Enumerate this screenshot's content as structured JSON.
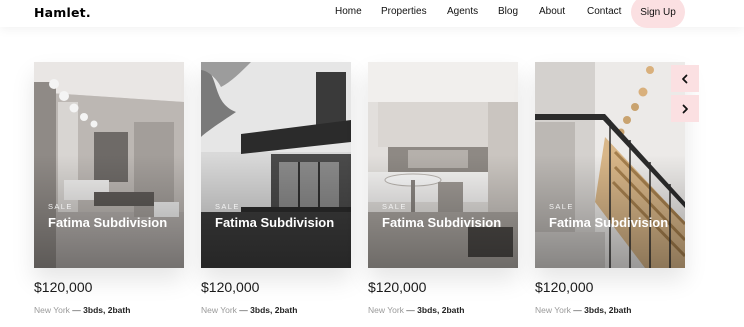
{
  "brand": {
    "name": "Hamlet."
  },
  "nav": {
    "links": [
      "Home",
      "Properties",
      "Agents",
      "Blog",
      "About",
      "Contact"
    ],
    "cta": "Sign Up"
  },
  "listings": [
    {
      "badge": "SALE",
      "title": "Fatima Subdivision",
      "price": "$120,000",
      "city": "New York",
      "separator": "—",
      "specs": "3bds, 2bath"
    },
    {
      "badge": "SALE",
      "title": "Fatima Subdivision",
      "price": "$120,000",
      "city": "New York",
      "separator": "—",
      "specs": "3bds, 2bath"
    },
    {
      "badge": "SALE",
      "title": "Fatima Subdivision",
      "price": "$120,000",
      "city": "New York",
      "separator": "—",
      "specs": "3bds, 2bath"
    },
    {
      "badge": "SALE",
      "title": "Fatima Subdivision",
      "price": "$120,000",
      "city": "New York",
      "separator": "—",
      "specs": "3bds, 2bath"
    }
  ],
  "carousel": {
    "prev_icon": "chevron-left-icon",
    "next_icon": "chevron-right-icon"
  },
  "colors": {
    "accent": "#fbe0e2",
    "text": "#111111",
    "muted": "#9a9a9a"
  }
}
